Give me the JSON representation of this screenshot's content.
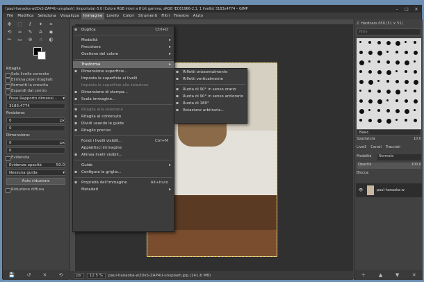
{
  "window": {
    "title": "[paul-hanaoka-w2DsS-ZAP4U-unsplash] (importata)-3.0 (Colore RGB interi a 8 bit gamma, sRGB IEC61966-2.1, 1 livello) 3183x4774 – GIMP"
  },
  "menubar": [
    "File",
    "Modifica",
    "Seleziona",
    "Visualizza",
    "Immagine",
    "Livello",
    "Colori",
    "Strumenti",
    "Filtri",
    "Finestre",
    "Aiuto"
  ],
  "tool_options": {
    "title": "Ritaglia",
    "options": [
      "Solo livello corrente",
      "Elimina pixel ritagliati",
      "Permetti la crescita",
      "Espandi dal centro"
    ],
    "ratio": "Fisso Rapporto dimensi...",
    "ratio_value": "3183:4774",
    "position_label": "Posizione:",
    "position_unit": "px",
    "pos_x": "0",
    "pos_y": "0",
    "size_label": "Dimensione:",
    "size_unit": "px",
    "size_w": "0",
    "size_h": "0",
    "highlight_label": "Evidenzia",
    "highlight_opacity_label": "Evidenza opacità",
    "highlight_opacity_value": "50.0",
    "guide": "Nessuna guida",
    "auto_button": "Auto riduzione",
    "shrink_merged": "Riduzione diffusa"
  },
  "menu": [
    {
      "label": "Duplica",
      "shortcut": "Ctrl+D",
      "icon": "copy-icon"
    },
    {
      "sep": true
    },
    {
      "label": "Modalità",
      "arrow": true
    },
    {
      "label": "Precisione",
      "arrow": true
    },
    {
      "label": "Gestione del colore",
      "arrow": true
    },
    {
      "sep": true
    },
    {
      "label": "Trasforma",
      "arrow": true,
      "highlight": true
    },
    {
      "label": "Dimensione superficie...",
      "icon": "canvas-size-icon"
    },
    {
      "label": "Imposta la superficie ai livelli"
    },
    {
      "label": "Imposta la superficie alla selezione",
      "disabled": true
    },
    {
      "label": "Dimensione di stampa...",
      "icon": "print-size-icon"
    },
    {
      "label": "Scala immagine...",
      "icon": "scale-icon"
    },
    {
      "sep": true
    },
    {
      "label": "Ritaglia alla selezione",
      "disabled": true,
      "icon": "crop-icon"
    },
    {
      "label": "Ritaglia al contenuto",
      "icon": "crop-icon"
    },
    {
      "label": "Dividi usando le guide",
      "icon": "guides-icon"
    },
    {
      "label": "Ritaglio preciso",
      "icon": "crop-icon"
    },
    {
      "sep": true
    },
    {
      "label": "Fondi i livelli visibili...",
      "shortcut": "Ctrl+M"
    },
    {
      "label": "Appiattisci immagine"
    },
    {
      "label": "Allinea livelli visibili...",
      "icon": "align-icon"
    },
    {
      "sep": true
    },
    {
      "label": "Guide",
      "arrow": true
    },
    {
      "label": "Configura la griglia...",
      "icon": "grid-icon"
    },
    {
      "sep": true
    },
    {
      "label": "Proprietà dell'immagine",
      "shortcut": "Alt+Invio",
      "icon": "info-icon"
    },
    {
      "label": "Metadati",
      "arrow": true
    }
  ],
  "submenu": [
    {
      "label": "Rifletti orizzontalmente",
      "icon": "flip-h-icon"
    },
    {
      "label": "Rifletti verticalmente",
      "icon": "flip-v-icon"
    },
    {
      "sep": true
    },
    {
      "label": "Ruota di 90° in senso orario",
      "icon": "rotate-cw-icon"
    },
    {
      "label": "Ruota di 90° in senso antiorario",
      "icon": "rotate-ccw-icon"
    },
    {
      "label": "Ruota di 180°",
      "icon": "rotate-180-icon"
    },
    {
      "label": "Rotazione arbitraria...",
      "icon": "rotate-icon"
    }
  ],
  "statusbar": {
    "unit": "px",
    "zoom": "12.5 %",
    "filename": "paul-hanaoka-w2DsS-ZAP4U-unsplash.jpg (141,6 MB)"
  },
  "brushes": {
    "title": "2. Hardness 050 (51 × 51)",
    "filter_placeholder": "filtro",
    "preset": "Basic.",
    "spacing_label": "Spaziatura",
    "spacing_value": "10.0"
  },
  "layers": {
    "tabs": [
      "Livelli",
      "Canali",
      "Tracciati"
    ],
    "mode_label": "Modalità",
    "mode": "Normale",
    "opacity_label": "Opacità",
    "opacity": "100.0",
    "lock_label": "Blocca:",
    "layer_name": "paul-hanaoka-w"
  }
}
